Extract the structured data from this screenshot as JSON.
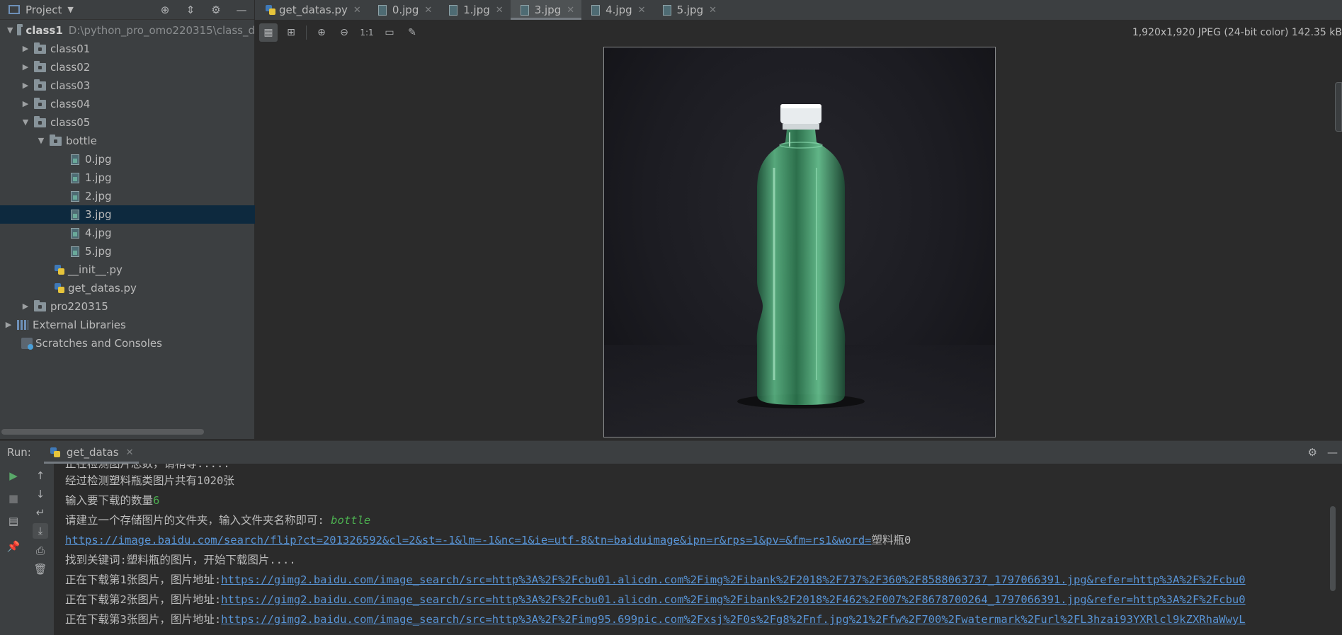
{
  "project_panel": {
    "title": "Project",
    "tree": [
      {
        "label": "class1",
        "path": "D:\\python_pro_omo220315\\class_d",
        "bold": true
      },
      {
        "label": "class01"
      },
      {
        "label": "class02"
      },
      {
        "label": "class03"
      },
      {
        "label": "class04"
      },
      {
        "label": "class05"
      },
      {
        "label": "bottle"
      },
      {
        "label": "0.jpg"
      },
      {
        "label": "1.jpg"
      },
      {
        "label": "2.jpg"
      },
      {
        "label": "3.jpg",
        "selected": true
      },
      {
        "label": "4.jpg"
      },
      {
        "label": "5.jpg"
      },
      {
        "label": "__init__.py"
      },
      {
        "label": "get_datas.py"
      },
      {
        "label": "pro220315"
      },
      {
        "label": "External Libraries"
      },
      {
        "label": "Scratches and Consoles"
      }
    ]
  },
  "tabs": [
    {
      "label": "get_datas.py",
      "active": false
    },
    {
      "label": "0.jpg",
      "active": false
    },
    {
      "label": "1.jpg",
      "active": false
    },
    {
      "label": "3.jpg",
      "active": true
    },
    {
      "label": "4.jpg",
      "active": false
    },
    {
      "label": "5.jpg",
      "active": false
    }
  ],
  "viewer": {
    "image_info": "1,920x1,920 JPEG (24-bit color) 142.35 kB",
    "zoom_actual_label": "1:1"
  },
  "run_panel": {
    "label": "Run:",
    "tab_label": "get_datas",
    "console": {
      "line0": "正在检测图片总数，请稍等.....",
      "line1": "经过检测塑料瓶类图片共有1020张",
      "line2_prefix": "输入要下载的数量",
      "line2_input": "6",
      "line3_prefix": "请建立一个存储图片的文件夹，输入文件夹名称即可: ",
      "line3_input": "bottle",
      "line4_link": "https://image.baidu.com/search/flip?ct=201326592&cl=2&st=-1&lm=-1&nc=1&ie=utf-8&tn=baiduimage&ipn=r&rps=1&pv=&fm=rs1&word=",
      "line4_suffix": "塑料瓶0",
      "line5": "找到关键词:塑料瓶的图片，开始下载图片....",
      "line6_prefix": "正在下载第1张图片，图片地址:",
      "line6_link": "https://gimg2.baidu.com/image_search/src=http%3A%2F%2Fcbu01.alicdn.com%2Fimg%2Fibank%2F2018%2F737%2F360%2F8588063737_1797066391.jpg&refer=http%3A%2F%2Fcbu0",
      "line7_prefix": "正在下载第2张图片，图片地址:",
      "line7_link": "https://gimg2.baidu.com/image_search/src=http%3A%2F%2Fcbu01.alicdn.com%2Fimg%2Fibank%2F2018%2F462%2F007%2F8678700264_1797066391.jpg&refer=http%3A%2F%2Fcbu0",
      "line8_prefix": "正在下载第3张图片，图片地址:",
      "line8_link": "https://gimg2.baidu.com/image_search/src=http%3A%2F%2Fimg95.699pic.com%2Fxsj%2F0s%2Fg8%2Fnf.jpg%21%2Ffw%2F700%2Fwatermark%2Furl%2FL3hzai93YXRlcl9kZXRhaWwyL"
    }
  },
  "colors": {
    "panel_bg": "#3c3f41",
    "editor_bg": "#2b2b2b",
    "selection": "#0d293e",
    "link": "#5894d6",
    "input_green": "#4caf50"
  }
}
